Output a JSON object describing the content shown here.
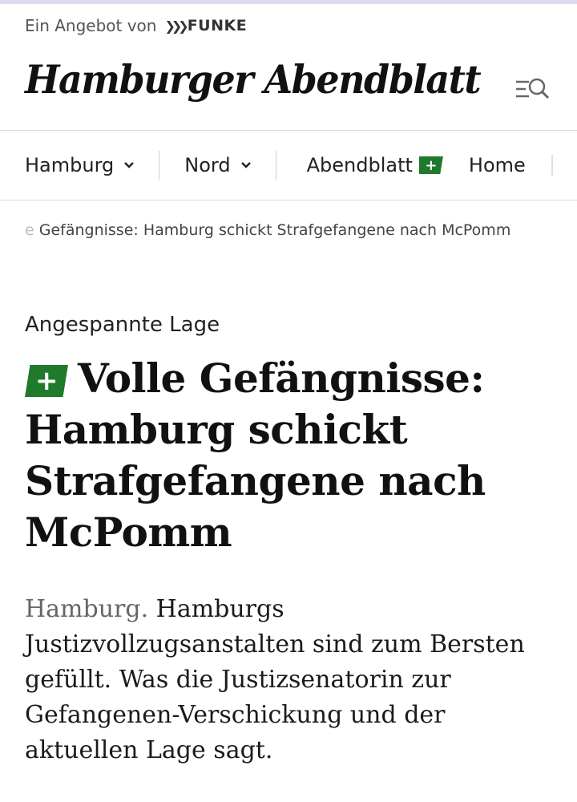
{
  "provider": {
    "prefix": "Ein Angebot von",
    "brand": "FUNKE"
  },
  "masthead": {
    "title": "Hamburger Abendblatt"
  },
  "nav": {
    "items": [
      {
        "label": "Hamburg"
      },
      {
        "label": "Nord"
      },
      {
        "label": "Abendblatt"
      },
      {
        "label": "Home"
      }
    ],
    "plus_symbol": "+"
  },
  "breadcrumb": {
    "fade": "e ",
    "text": "Gefängnisse: Hamburg schickt Strafgefangene nach McPomm"
  },
  "article": {
    "kicker": "Angespannte Lage",
    "plus_symbol": "+",
    "headline": "Volle Gefängnisse: Hamburg schickt Strafgefangene nach McPomm",
    "dateline": "Hamburg.",
    "teaser": "Hamburgs Justizvollzugsanstalten sind zum Bersten gefüllt. Was die Justizsenatorin zur Gefangenen-Verschickung und der aktuellen Lage sagt."
  },
  "colors": {
    "plus_green": "#1f7a2b"
  }
}
